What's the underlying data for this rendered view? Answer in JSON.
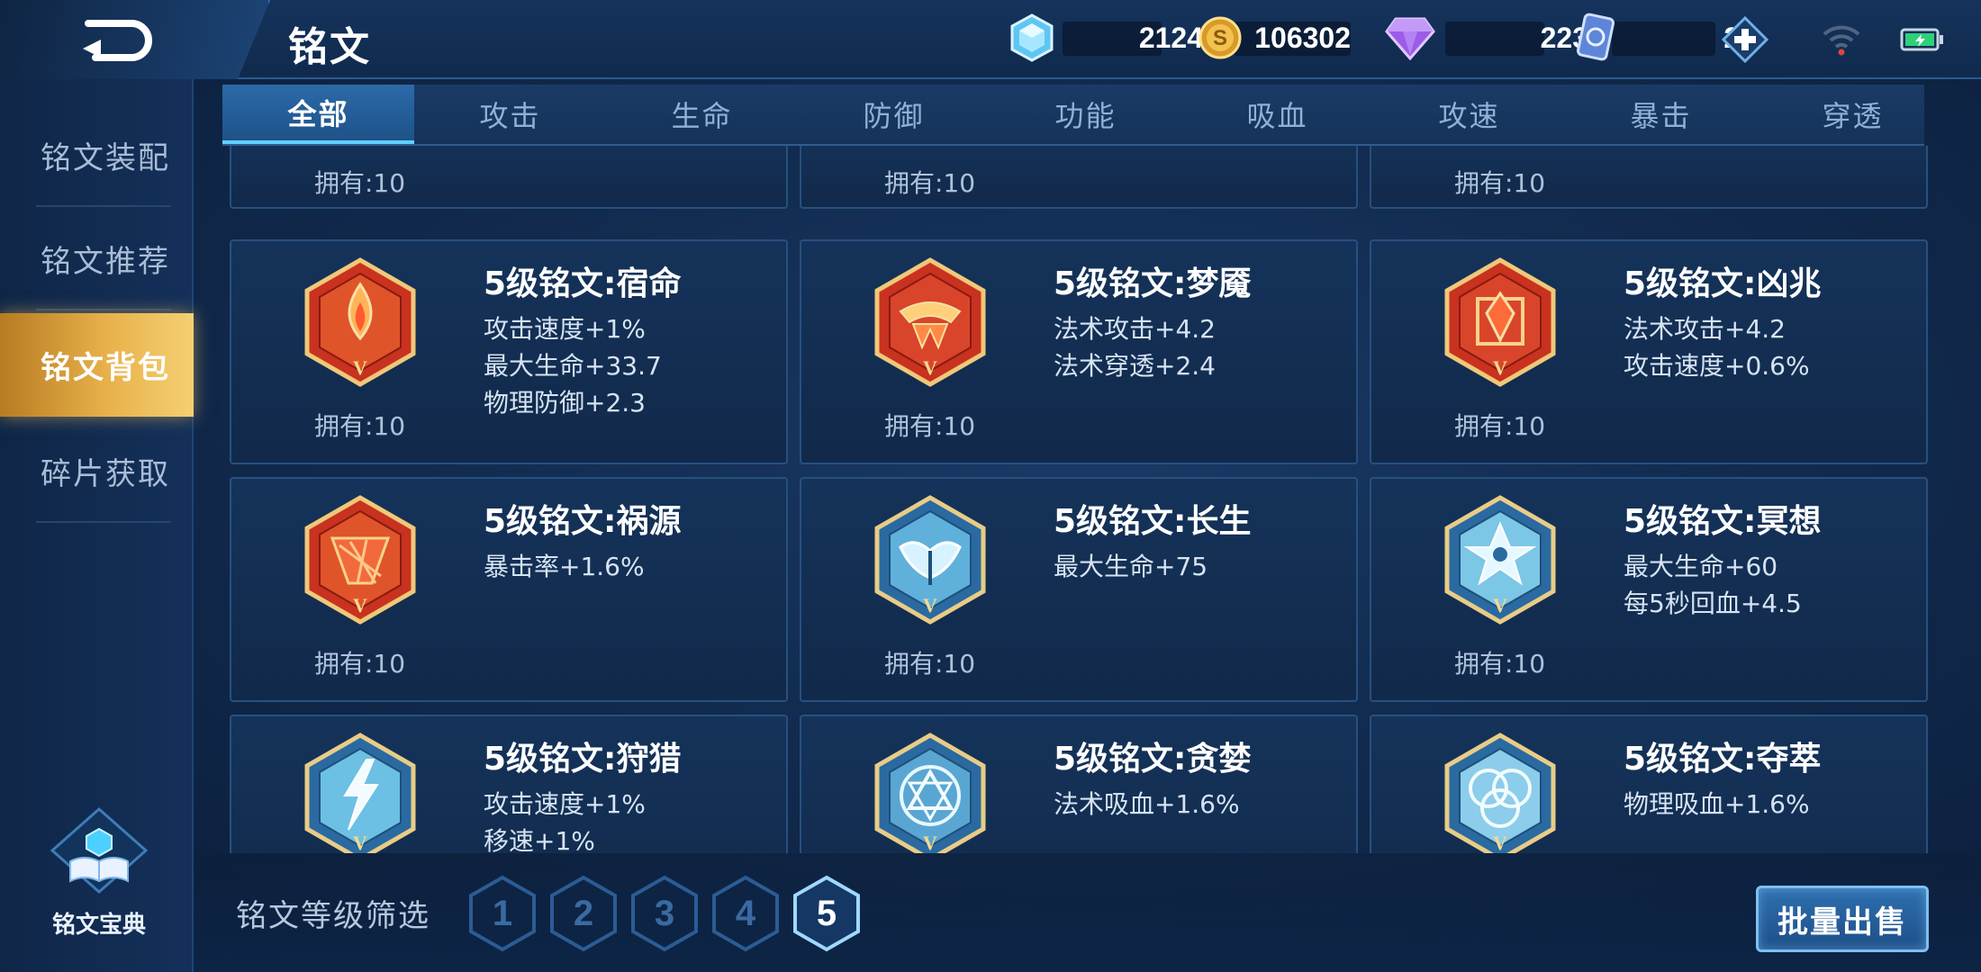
{
  "header": {
    "title": "铭文",
    "resources": [
      {
        "icon": "crystal-gem-icon",
        "amount": "2124"
      },
      {
        "icon": "gold-coin-icon",
        "amount": "106302"
      },
      {
        "icon": "purple-diamond-icon",
        "amount": "223"
      },
      {
        "icon": "card-ticket-icon",
        "amount": "24"
      }
    ]
  },
  "sidebar": {
    "items": [
      {
        "label": "铭文装配",
        "active": false
      },
      {
        "label": "铭文推荐",
        "active": false
      },
      {
        "label": "铭文背包",
        "active": true
      },
      {
        "label": "碎片获取",
        "active": false
      }
    ],
    "codex_label": "铭文宝典"
  },
  "tabs": [
    "全部",
    "攻击",
    "生命",
    "防御",
    "功能",
    "吸血",
    "攻速",
    "暴击",
    "穿透"
  ],
  "active_tab": "全部",
  "top_partial_owned": [
    "拥有:10",
    "拥有:10",
    "拥有:10"
  ],
  "cards": [
    {
      "name": "5级铭文:宿命",
      "stats": [
        "攻击速度+1%",
        "最大生命+33.7",
        "物理防御+2.3"
      ],
      "owned": "拥有:10",
      "theme": "red"
    },
    {
      "name": "5级铭文:梦魇",
      "stats": [
        "法术攻击+4.2",
        "法术穿透+2.4"
      ],
      "owned": "拥有:10",
      "theme": "red"
    },
    {
      "name": "5级铭文:凶兆",
      "stats": [
        "法术攻击+4.2",
        "攻击速度+0.6%"
      ],
      "owned": "拥有:10",
      "theme": "red"
    },
    {
      "name": "5级铭文:祸源",
      "stats": [
        "暴击率+1.6%"
      ],
      "owned": "拥有:10",
      "theme": "red"
    },
    {
      "name": "5级铭文:长生",
      "stats": [
        "最大生命+75"
      ],
      "owned": "拥有:10",
      "theme": "blue"
    },
    {
      "name": "5级铭文:冥想",
      "stats": [
        "最大生命+60",
        "每5秒回血+4.5"
      ],
      "owned": "拥有:10",
      "theme": "blue"
    },
    {
      "name": "5级铭文:狩猎",
      "stats": [
        "攻击速度+1%",
        "移速+1%"
      ],
      "owned": "",
      "theme": "blue"
    },
    {
      "name": "5级铭文:贪婪",
      "stats": [
        "法术吸血+1.6%"
      ],
      "owned": "",
      "theme": "blue"
    },
    {
      "name": "5级铭文:夺萃",
      "stats": [
        "物理吸血+1.6%"
      ],
      "owned": "",
      "theme": "blue"
    }
  ],
  "filter": {
    "label": "铭文等级筛选",
    "levels": [
      "1",
      "2",
      "3",
      "4",
      "5"
    ],
    "selected": "5"
  },
  "sell_button_label": "批量出售",
  "colors": {
    "accent_gold": "#e8b14a",
    "accent_cyan": "#5fd1ff",
    "rune_red": "#c8321f",
    "rune_blue": "#7cc6e6"
  }
}
